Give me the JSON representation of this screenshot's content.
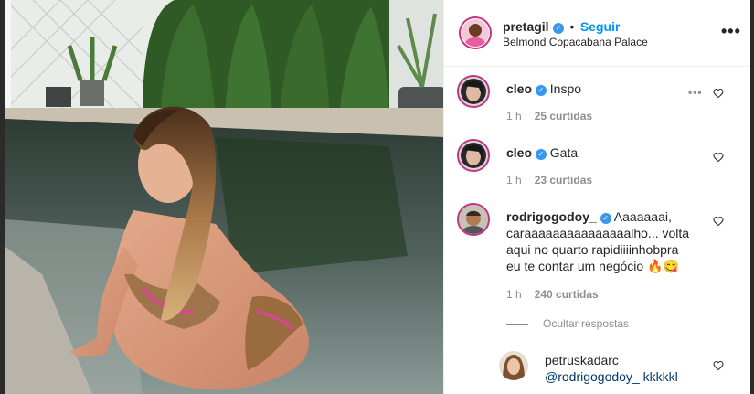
{
  "post": {
    "username": "pretagil",
    "follow_label": "Seguir",
    "separator": "•",
    "location": "Belmond Copacabana Palace",
    "more_icon": "more-options-icon"
  },
  "comments": [
    {
      "username": "cleo",
      "text": "Inspo",
      "time": "1 h",
      "likes": "25 curtidas"
    },
    {
      "username": "cleo",
      "text": "Gata",
      "time": "1 h",
      "likes": "23 curtidas"
    },
    {
      "username": "rodrigogodoy_",
      "text_lines": [
        "Aaaaaaai,",
        "caraaaaaaaaaaaaaaalho... volta",
        "aqui no quarto rapidiiiinhobpra",
        "eu te contar um negócio 🔥😋"
      ],
      "time": "1 h",
      "likes": "240 curtidas"
    }
  ],
  "replies_toggle": "Ocultar respostas",
  "reply": {
    "username": "petruskadarc",
    "text": "@rodrigogodoy_ kkkkkl"
  },
  "colors": {
    "accent": "#0095f6",
    "verified": "#3897f0",
    "text": "#262626",
    "muted": "#8e8e8e",
    "story_ring": "#c13584"
  }
}
